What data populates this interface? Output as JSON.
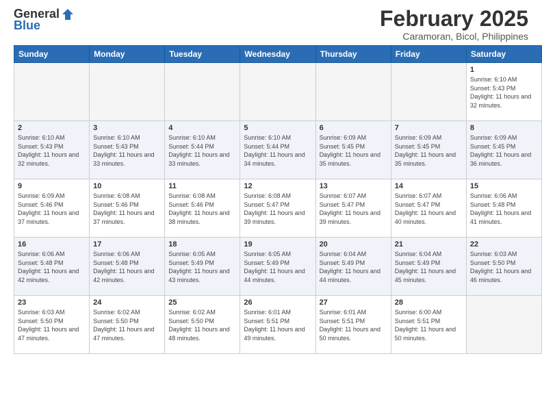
{
  "header": {
    "logo_general": "General",
    "logo_blue": "Blue",
    "month_title": "February 2025",
    "location": "Caramoran, Bicol, Philippines"
  },
  "days_of_week": [
    "Sunday",
    "Monday",
    "Tuesday",
    "Wednesday",
    "Thursday",
    "Friday",
    "Saturday"
  ],
  "weeks": [
    [
      {
        "day": "",
        "empty": true
      },
      {
        "day": "",
        "empty": true
      },
      {
        "day": "",
        "empty": true
      },
      {
        "day": "",
        "empty": true
      },
      {
        "day": "",
        "empty": true
      },
      {
        "day": "",
        "empty": true
      },
      {
        "day": "1",
        "sunrise": "6:10 AM",
        "sunset": "5:43 PM",
        "daylight": "11 hours and 32 minutes."
      }
    ],
    [
      {
        "day": "2",
        "sunrise": "6:10 AM",
        "sunset": "5:43 PM",
        "daylight": "11 hours and 32 minutes."
      },
      {
        "day": "3",
        "sunrise": "6:10 AM",
        "sunset": "5:43 PM",
        "daylight": "11 hours and 33 minutes."
      },
      {
        "day": "4",
        "sunrise": "6:10 AM",
        "sunset": "5:44 PM",
        "daylight": "11 hours and 33 minutes."
      },
      {
        "day": "5",
        "sunrise": "6:10 AM",
        "sunset": "5:44 PM",
        "daylight": "11 hours and 34 minutes."
      },
      {
        "day": "6",
        "sunrise": "6:09 AM",
        "sunset": "5:45 PM",
        "daylight": "11 hours and 35 minutes."
      },
      {
        "day": "7",
        "sunrise": "6:09 AM",
        "sunset": "5:45 PM",
        "daylight": "11 hours and 35 minutes."
      },
      {
        "day": "8",
        "sunrise": "6:09 AM",
        "sunset": "5:45 PM",
        "daylight": "11 hours and 36 minutes."
      }
    ],
    [
      {
        "day": "9",
        "sunrise": "6:09 AM",
        "sunset": "5:46 PM",
        "daylight": "11 hours and 37 minutes."
      },
      {
        "day": "10",
        "sunrise": "6:08 AM",
        "sunset": "5:46 PM",
        "daylight": "11 hours and 37 minutes."
      },
      {
        "day": "11",
        "sunrise": "6:08 AM",
        "sunset": "5:46 PM",
        "daylight": "11 hours and 38 minutes."
      },
      {
        "day": "12",
        "sunrise": "6:08 AM",
        "sunset": "5:47 PM",
        "daylight": "11 hours and 39 minutes."
      },
      {
        "day": "13",
        "sunrise": "6:07 AM",
        "sunset": "5:47 PM",
        "daylight": "11 hours and 39 minutes."
      },
      {
        "day": "14",
        "sunrise": "6:07 AM",
        "sunset": "5:47 PM",
        "daylight": "11 hours and 40 minutes."
      },
      {
        "day": "15",
        "sunrise": "6:06 AM",
        "sunset": "5:48 PM",
        "daylight": "11 hours and 41 minutes."
      }
    ],
    [
      {
        "day": "16",
        "sunrise": "6:06 AM",
        "sunset": "5:48 PM",
        "daylight": "11 hours and 42 minutes."
      },
      {
        "day": "17",
        "sunrise": "6:06 AM",
        "sunset": "5:48 PM",
        "daylight": "11 hours and 42 minutes."
      },
      {
        "day": "18",
        "sunrise": "6:05 AM",
        "sunset": "5:49 PM",
        "daylight": "11 hours and 43 minutes."
      },
      {
        "day": "19",
        "sunrise": "6:05 AM",
        "sunset": "5:49 PM",
        "daylight": "11 hours and 44 minutes."
      },
      {
        "day": "20",
        "sunrise": "6:04 AM",
        "sunset": "5:49 PM",
        "daylight": "11 hours and 44 minutes."
      },
      {
        "day": "21",
        "sunrise": "6:04 AM",
        "sunset": "5:49 PM",
        "daylight": "11 hours and 45 minutes."
      },
      {
        "day": "22",
        "sunrise": "6:03 AM",
        "sunset": "5:50 PM",
        "daylight": "11 hours and 46 minutes."
      }
    ],
    [
      {
        "day": "23",
        "sunrise": "6:03 AM",
        "sunset": "5:50 PM",
        "daylight": "11 hours and 47 minutes."
      },
      {
        "day": "24",
        "sunrise": "6:02 AM",
        "sunset": "5:50 PM",
        "daylight": "11 hours and 47 minutes."
      },
      {
        "day": "25",
        "sunrise": "6:02 AM",
        "sunset": "5:50 PM",
        "daylight": "11 hours and 48 minutes."
      },
      {
        "day": "26",
        "sunrise": "6:01 AM",
        "sunset": "5:51 PM",
        "daylight": "11 hours and 49 minutes."
      },
      {
        "day": "27",
        "sunrise": "6:01 AM",
        "sunset": "5:51 PM",
        "daylight": "11 hours and 50 minutes."
      },
      {
        "day": "28",
        "sunrise": "6:00 AM",
        "sunset": "5:51 PM",
        "daylight": "11 hours and 50 minutes."
      },
      {
        "day": "",
        "empty": true
      }
    ]
  ]
}
